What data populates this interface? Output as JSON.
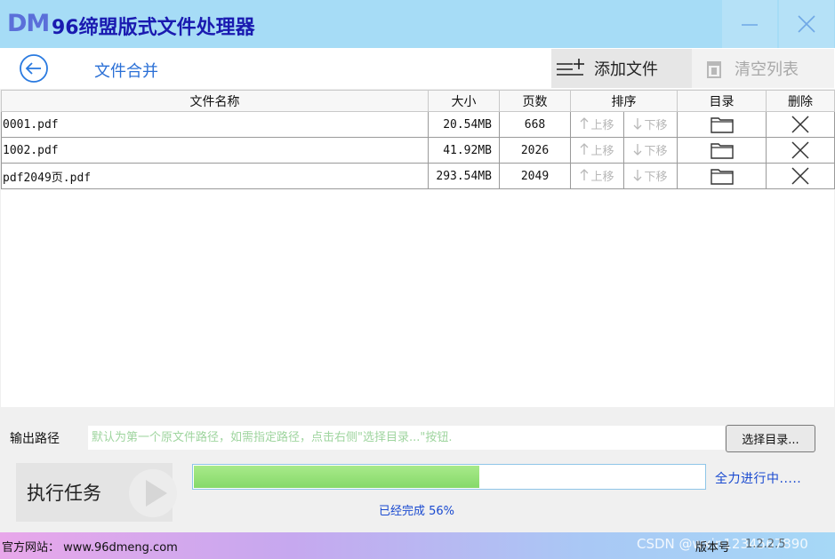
{
  "window": {
    "logo": "DM",
    "title": "96缔盟版式文件处理器"
  },
  "toolbar": {
    "section_title": "文件合并",
    "add_label": "添加文件",
    "clear_label": "清空列表"
  },
  "table": {
    "columns": [
      "文件名称",
      "大小",
      "页数",
      "排序",
      "目录",
      "删除"
    ],
    "move_up": "上移",
    "move_down": "下移",
    "rows": [
      {
        "name": "0001.pdf",
        "size": "20.54MB",
        "pages": "668"
      },
      {
        "name": "1002.pdf",
        "size": "41.92MB",
        "pages": "2026"
      },
      {
        "name": "pdf2049页.pdf",
        "size": "293.54MB",
        "pages": "2049"
      }
    ]
  },
  "output": {
    "label": "输出路径",
    "placeholder": "默认为第一个原文件路径，如需指定路径，点击右侧\"选择目录...\"按钮.",
    "choose_label": "选择目录..."
  },
  "task": {
    "run_label": "执行任务",
    "progress_percent": 56,
    "progress_text": "已经完成 56%",
    "status": "全力进行中....."
  },
  "footer": {
    "site": "官方网站： www.96dmeng.com",
    "watermark": "CSDN @wxin1234567890",
    "version_label": "版本号",
    "version_value": "1.2.2.5"
  },
  "colors": {
    "titlebar": "#a6dcf6",
    "title_text": "#1a1ab0",
    "accent_blue": "#2a6fd6",
    "progress_green": "#8fdc6f",
    "placeholder_green": "#9fd59f"
  }
}
